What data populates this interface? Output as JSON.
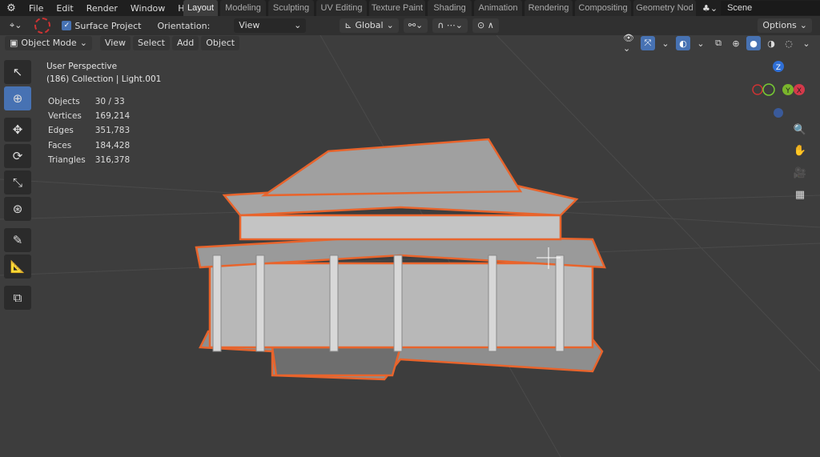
{
  "menubar": {
    "items": [
      "File",
      "Edit",
      "Render",
      "Window",
      "Help"
    ]
  },
  "workspaces": [
    "Layout",
    "Modeling",
    "Sculpting",
    "UV Editing",
    "Texture Paint",
    "Shading",
    "Animation",
    "Rendering",
    "Compositing",
    "Geometry Nod"
  ],
  "active_workspace": "Layout",
  "scene": "Scene",
  "tool_header": {
    "surface_project": "Surface Project",
    "orientation_label": "Orientation:",
    "orientation_value": "View",
    "transform_orientation": "Global",
    "options": "Options"
  },
  "viewport_header": {
    "mode": "Object Mode",
    "menus": [
      "View",
      "Select",
      "Add",
      "Object"
    ]
  },
  "overlay": {
    "view_name": "User Perspective",
    "collection": "(186) Collection | Light.001"
  },
  "stats": [
    {
      "label": "Objects",
      "value": "30 / 33"
    },
    {
      "label": "Vertices",
      "value": "169,214"
    },
    {
      "label": "Edges",
      "value": "351,783"
    },
    {
      "label": "Faces",
      "value": "184,428"
    },
    {
      "label": "Triangles",
      "value": "316,378"
    }
  ],
  "gizmo": {
    "z": "Z",
    "y": "Y",
    "x": "X"
  },
  "colors": {
    "accent": "#4772b3",
    "selection": "#e8642c",
    "viewport": "#3d3d3d"
  }
}
